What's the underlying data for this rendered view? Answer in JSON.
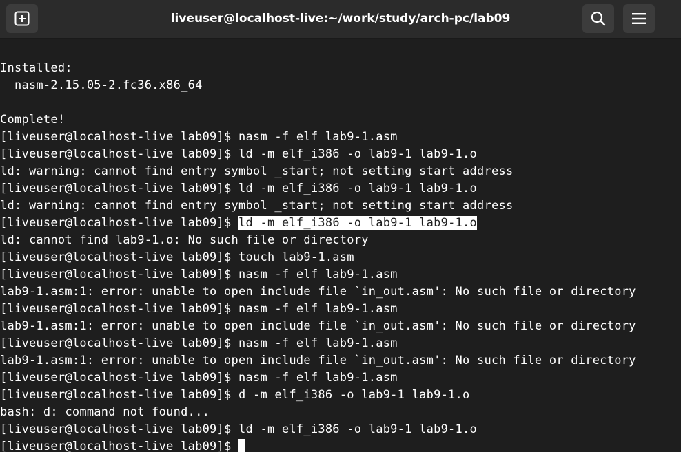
{
  "window": {
    "title": "liveuser@localhost-live:~/work/study/arch-pc/lab09"
  },
  "header": {
    "new_tab_icon": "new-tab-plus-icon",
    "search_icon": "search-icon",
    "menu_icon": "hamburger-menu-icon"
  },
  "colors": {
    "background": "#1e1e1e",
    "titlebar": "#2b2b2b",
    "button": "#3c3c3c",
    "text": "#ffffff"
  },
  "terminal": {
    "lines": [
      "Installed:",
      "  nasm-2.15.05-2.fc36.x86_64",
      "",
      "Complete!",
      "[liveuser@localhost-live lab09]$ nasm -f elf lab9-1.asm",
      "[liveuser@localhost-live lab09]$ ld -m elf_i386 -o lab9-1 lab9-1.o",
      "ld: warning: cannot find entry symbol _start; not setting start address",
      "[liveuser@localhost-live lab09]$ ld -m elf_i386 -o lab9-1 lab9-1.o",
      "ld: warning: cannot find entry symbol _start; not setting start address",
      "[liveuser@localhost-live lab09]$ ",
      "ld: cannot find lab9-1.o: No such file or directory",
      "[liveuser@localhost-live lab09]$ touch lab9-1.asm",
      "[liveuser@localhost-live lab09]$ nasm -f elf lab9-1.asm",
      "lab9-1.asm:1: error: unable to open include file `in_out.asm': No such file or directory",
      "[liveuser@localhost-live lab09]$ nasm -f elf lab9-1.asm",
      "lab9-1.asm:1: error: unable to open include file `in_out.asm': No such file or directory",
      "[liveuser@localhost-live lab09]$ nasm -f elf lab9-1.asm",
      "lab9-1.asm:1: error: unable to open include file `in_out.asm': No such file or directory",
      "[liveuser@localhost-live lab09]$ nasm -f elf lab9-1.asm",
      "[liveuser@localhost-live lab09]$ d -m elf_i386 -o lab9-1 lab9-1.o",
      "bash: d: command not found...",
      "[liveuser@localhost-live lab09]$ ld -m elf_i386 -o lab9-1 lab9-1.o",
      "[liveuser@localhost-live lab09]$ "
    ],
    "selected_text": "ld -m elf_i386 -o lab9-1 lab9-1.o"
  }
}
